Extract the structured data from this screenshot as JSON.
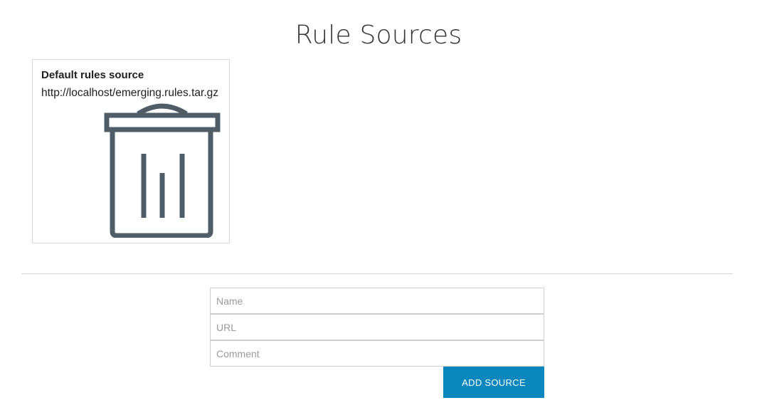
{
  "page": {
    "title": "Rule Sources"
  },
  "sources": [
    {
      "name": "Default rules source",
      "url": "http://localhost/emerging.rules.tar.gz",
      "delete_icon": "trash-icon"
    }
  ],
  "form": {
    "name_placeholder": "Name",
    "url_placeholder": "URL",
    "comment_placeholder": "Comment",
    "submit_label": "ADD SOURCE"
  },
  "colors": {
    "accent": "#0a87bd",
    "icon": "#4f5d69",
    "border": "#d8d8d8"
  }
}
